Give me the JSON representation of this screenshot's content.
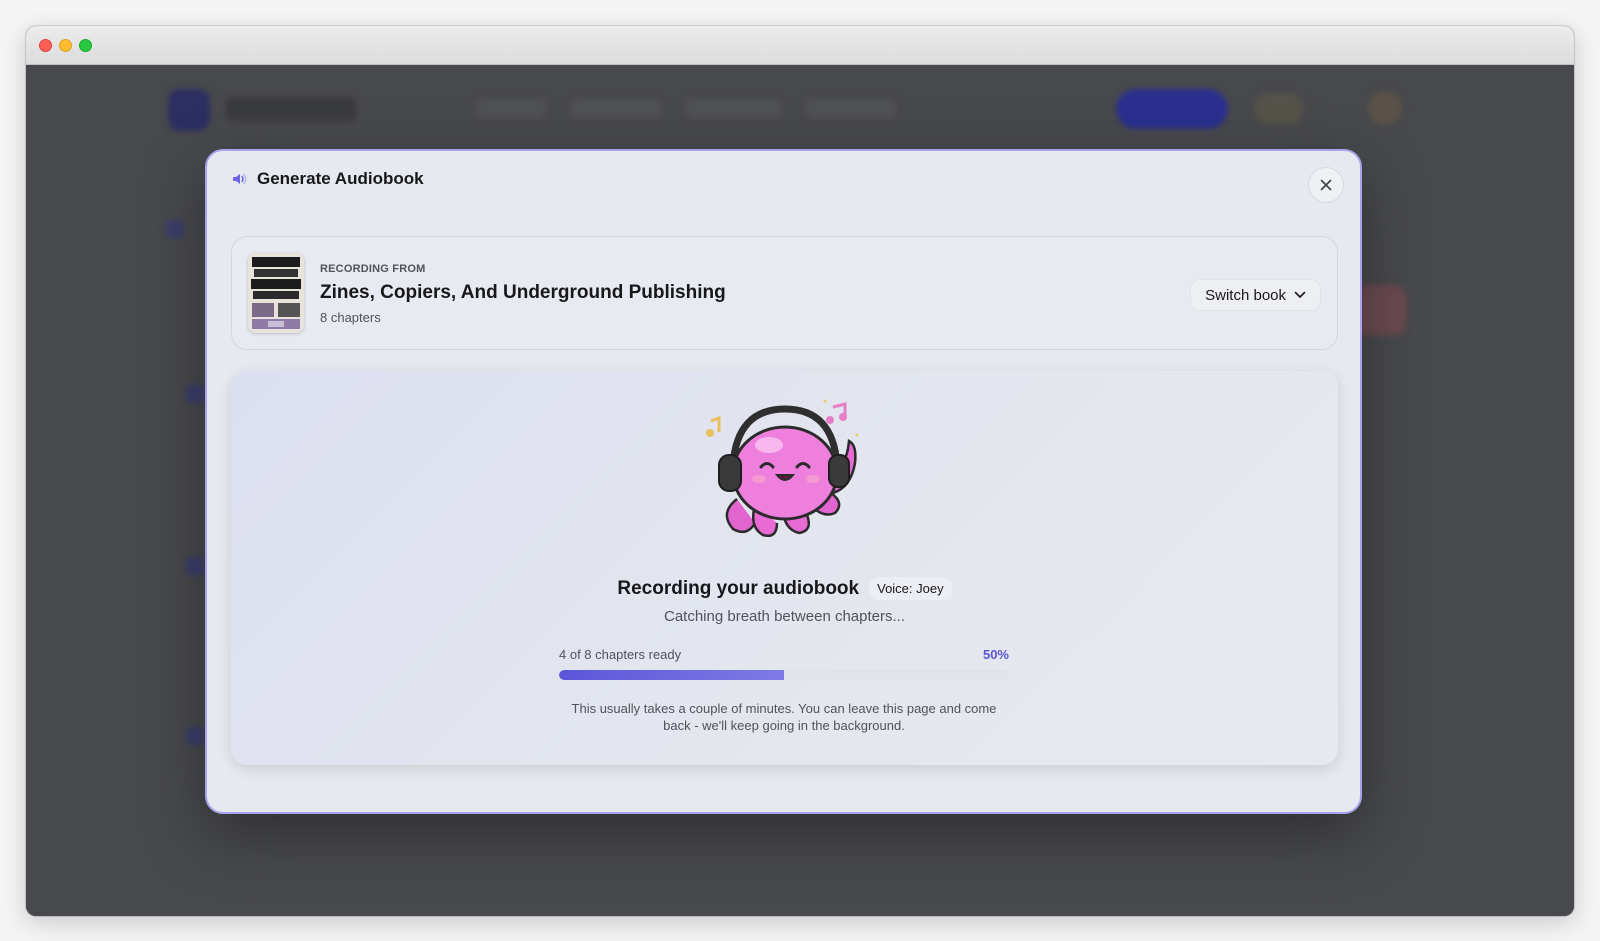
{
  "modal": {
    "title": "Generate Audiobook",
    "title_icon": "speaker-icon",
    "close_icon": "close-icon"
  },
  "book": {
    "recording_from_label": "RECORDING FROM",
    "title": "Zines, Copiers, And Underground Publishing",
    "chapters": "8 chapters",
    "switch_label": "Switch book",
    "cover_title_lines": [
      "ZINES,",
      "COPIERS,",
      "UNDERGROUND",
      "PUBLISHING"
    ]
  },
  "progress": {
    "title": "Recording your audiobook",
    "voice": "Voice: Joey",
    "subtitle": "Catching breath between chapters...",
    "chapters_ready_label": "4 of 8 chapters ready",
    "chapters_ready": 4,
    "chapters_total": 8,
    "percent_label": "50%",
    "percent": 50,
    "note": "This usually takes a couple of minutes. You can leave this page and come back - we'll keep going in the background."
  },
  "colors": {
    "accent": "#5b56d8",
    "modal_border": "#a9a3ee",
    "mascot_pink": "#ea72d8"
  }
}
